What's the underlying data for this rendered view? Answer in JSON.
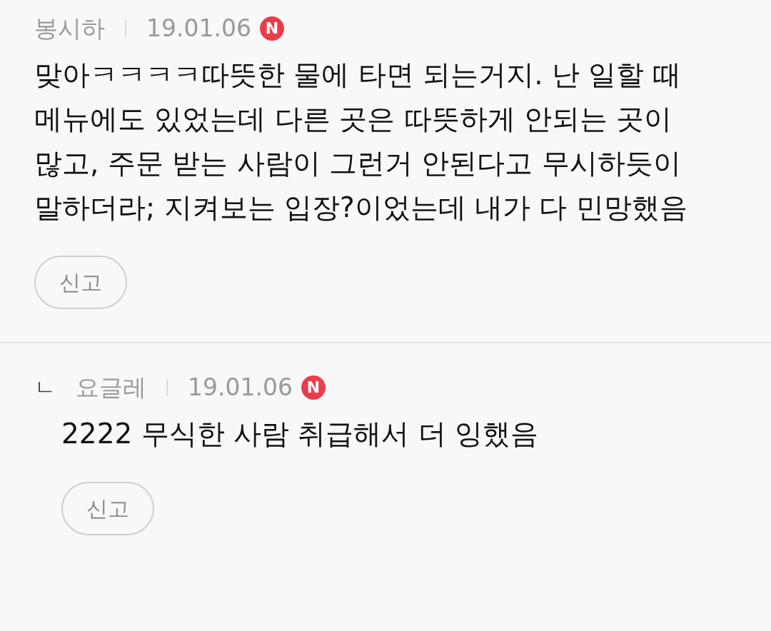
{
  "comments": [
    {
      "kind": "comment",
      "author": "봉시하",
      "date": "19.01.06",
      "badge": "N",
      "text": "맞아ㅋㅋㅋㅋ따뜻한 물에 타면 되는거지. 난 일할 때 메뉴에도 있었는데 다른 곳은 따뜻하게 안되는 곳이 많고, 주문 받는 사람이 그런거 안된다고 무시하듯이 말하더라; 지켜보는 입장?이었는데 내가 다 민망했음",
      "report": "신고"
    },
    {
      "kind": "reply",
      "marker": "ㄴ",
      "author": "요글레",
      "date": "19.01.06",
      "badge": "N",
      "text": "2222 무식한 사람 취급해서 더 잉했음",
      "report": "신고"
    }
  ]
}
